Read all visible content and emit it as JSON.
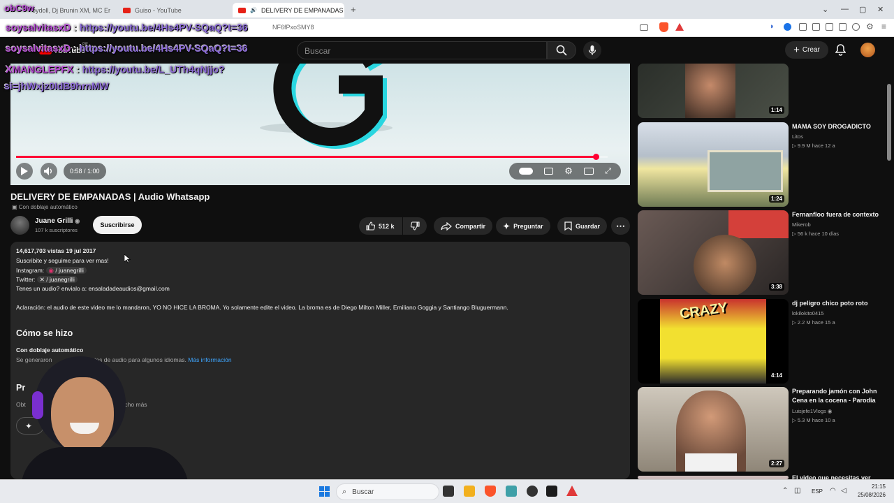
{
  "browser": {
    "tabs": [
      {
        "label": "oydoll, Dj Brunin XM, MC Erik"
      },
      {
        "label": "Guiso - YouTube"
      },
      {
        "label": "DELIVERY DE EMPANADAS | A"
      }
    ],
    "new_tab": "+",
    "window_controls": {
      "chevron": "⌄",
      "min": "—",
      "max": "▢",
      "close": "✕"
    },
    "url_suffix": "NF6fPxoSMY8"
  },
  "chat": {
    "top_left": "obC9w",
    "line1": {
      "user": "soysalvitasxD",
      "sep": ":",
      "url": "https://youtu.be/4Hs4PV-SQaQ?t=36"
    },
    "line2": {
      "user": "soysalvitasxD",
      "sep": ":",
      "url": "https://youtu.be/4Hs4PV-SQaQ?t=36"
    },
    "line3": {
      "user": "XMANGLEPFX",
      "sep": ":",
      "url": "https://youtu.be/L_UTh4qNjjo?"
    },
    "line4": {
      "text": "si=jhWxjz0IdB9hrnMW"
    }
  },
  "youtube": {
    "logo_text": "YouTube",
    "logo_sup": "PE",
    "search_placeholder": "Buscar",
    "create_label": "Crear",
    "player": {
      "time": "0:58 / 1:00",
      "progress": 0.98
    },
    "title": "DELIVERY DE EMPANADAS | Audio Whatsapp",
    "dub_badge": "Con doblaje automático",
    "channel": {
      "name": "Juane Grilli",
      "subs": "107 k suscriptores",
      "subscribe": "Suscribirse"
    },
    "actions": {
      "likes": "512 k",
      "share": "Compartir",
      "ask": "Preguntar",
      "save": "Guardar"
    },
    "description": {
      "views_date": "14,617,703 vistas  19 jul 2017",
      "l1": "Suscribite y seguime para ver mas!",
      "l2_prefix": "Instagram:",
      "l2_handle": "/ juanegrilli",
      "l3_prefix": "Twitter:",
      "l3_handle": "/ juanegrilli",
      "l4": "Tenes un audio? envialo a: ensaladadeaudios@gmail.com",
      "l5": "Aclaración: el audio de este video me lo mandaron, YO NO HICE LA BROMA. Yo solamente edite el video. La broma es de Diego Milton Miller, Emiliano Goggia y Santiango Bluguermann.",
      "how_heading": "Cómo se hizo",
      "how_sub": "Con doblaje automático",
      "how_text_a": "Se generaron",
      "how_text_b": "nte pistas de audio para algunos idiomas.",
      "more_info": "Más información",
      "pr_heading": "Pr",
      "pr_text_a": "Obt",
      "pr_text_b": "y mucho más"
    },
    "sidebar": [
      {
        "duration": "1:14",
        "title": "",
        "channel": "",
        "meta": ""
      },
      {
        "duration": "1:24",
        "title": "MAMA SOY DROGADICTO",
        "channel": "Litos",
        "meta": "▷ 9.9 M  hace 12 a"
      },
      {
        "duration": "3:38",
        "title": "Fernanfloo fuera de contexto",
        "channel": "Mikerob",
        "meta": "▷ 56 k  hace 10 días"
      },
      {
        "duration": "4:14",
        "title": "dj peligro chico poto roto",
        "channel": "lokilokito0415",
        "meta": "▷ 2.2 M  hace 15 a"
      },
      {
        "duration": "2:27",
        "title": "Preparando jamón con John Cena en la cocena - Parodia",
        "channel": "Luisjefe1Vlogs",
        "meta": "▷ 5.3 M  hace 10 a"
      },
      {
        "title": "El video que necesitas ver"
      }
    ],
    "thumb4_text": "CRAZY"
  },
  "taskbar": {
    "search": "Buscar",
    "lang": "ESP",
    "time": "21:15",
    "date": "25/08/2026"
  }
}
